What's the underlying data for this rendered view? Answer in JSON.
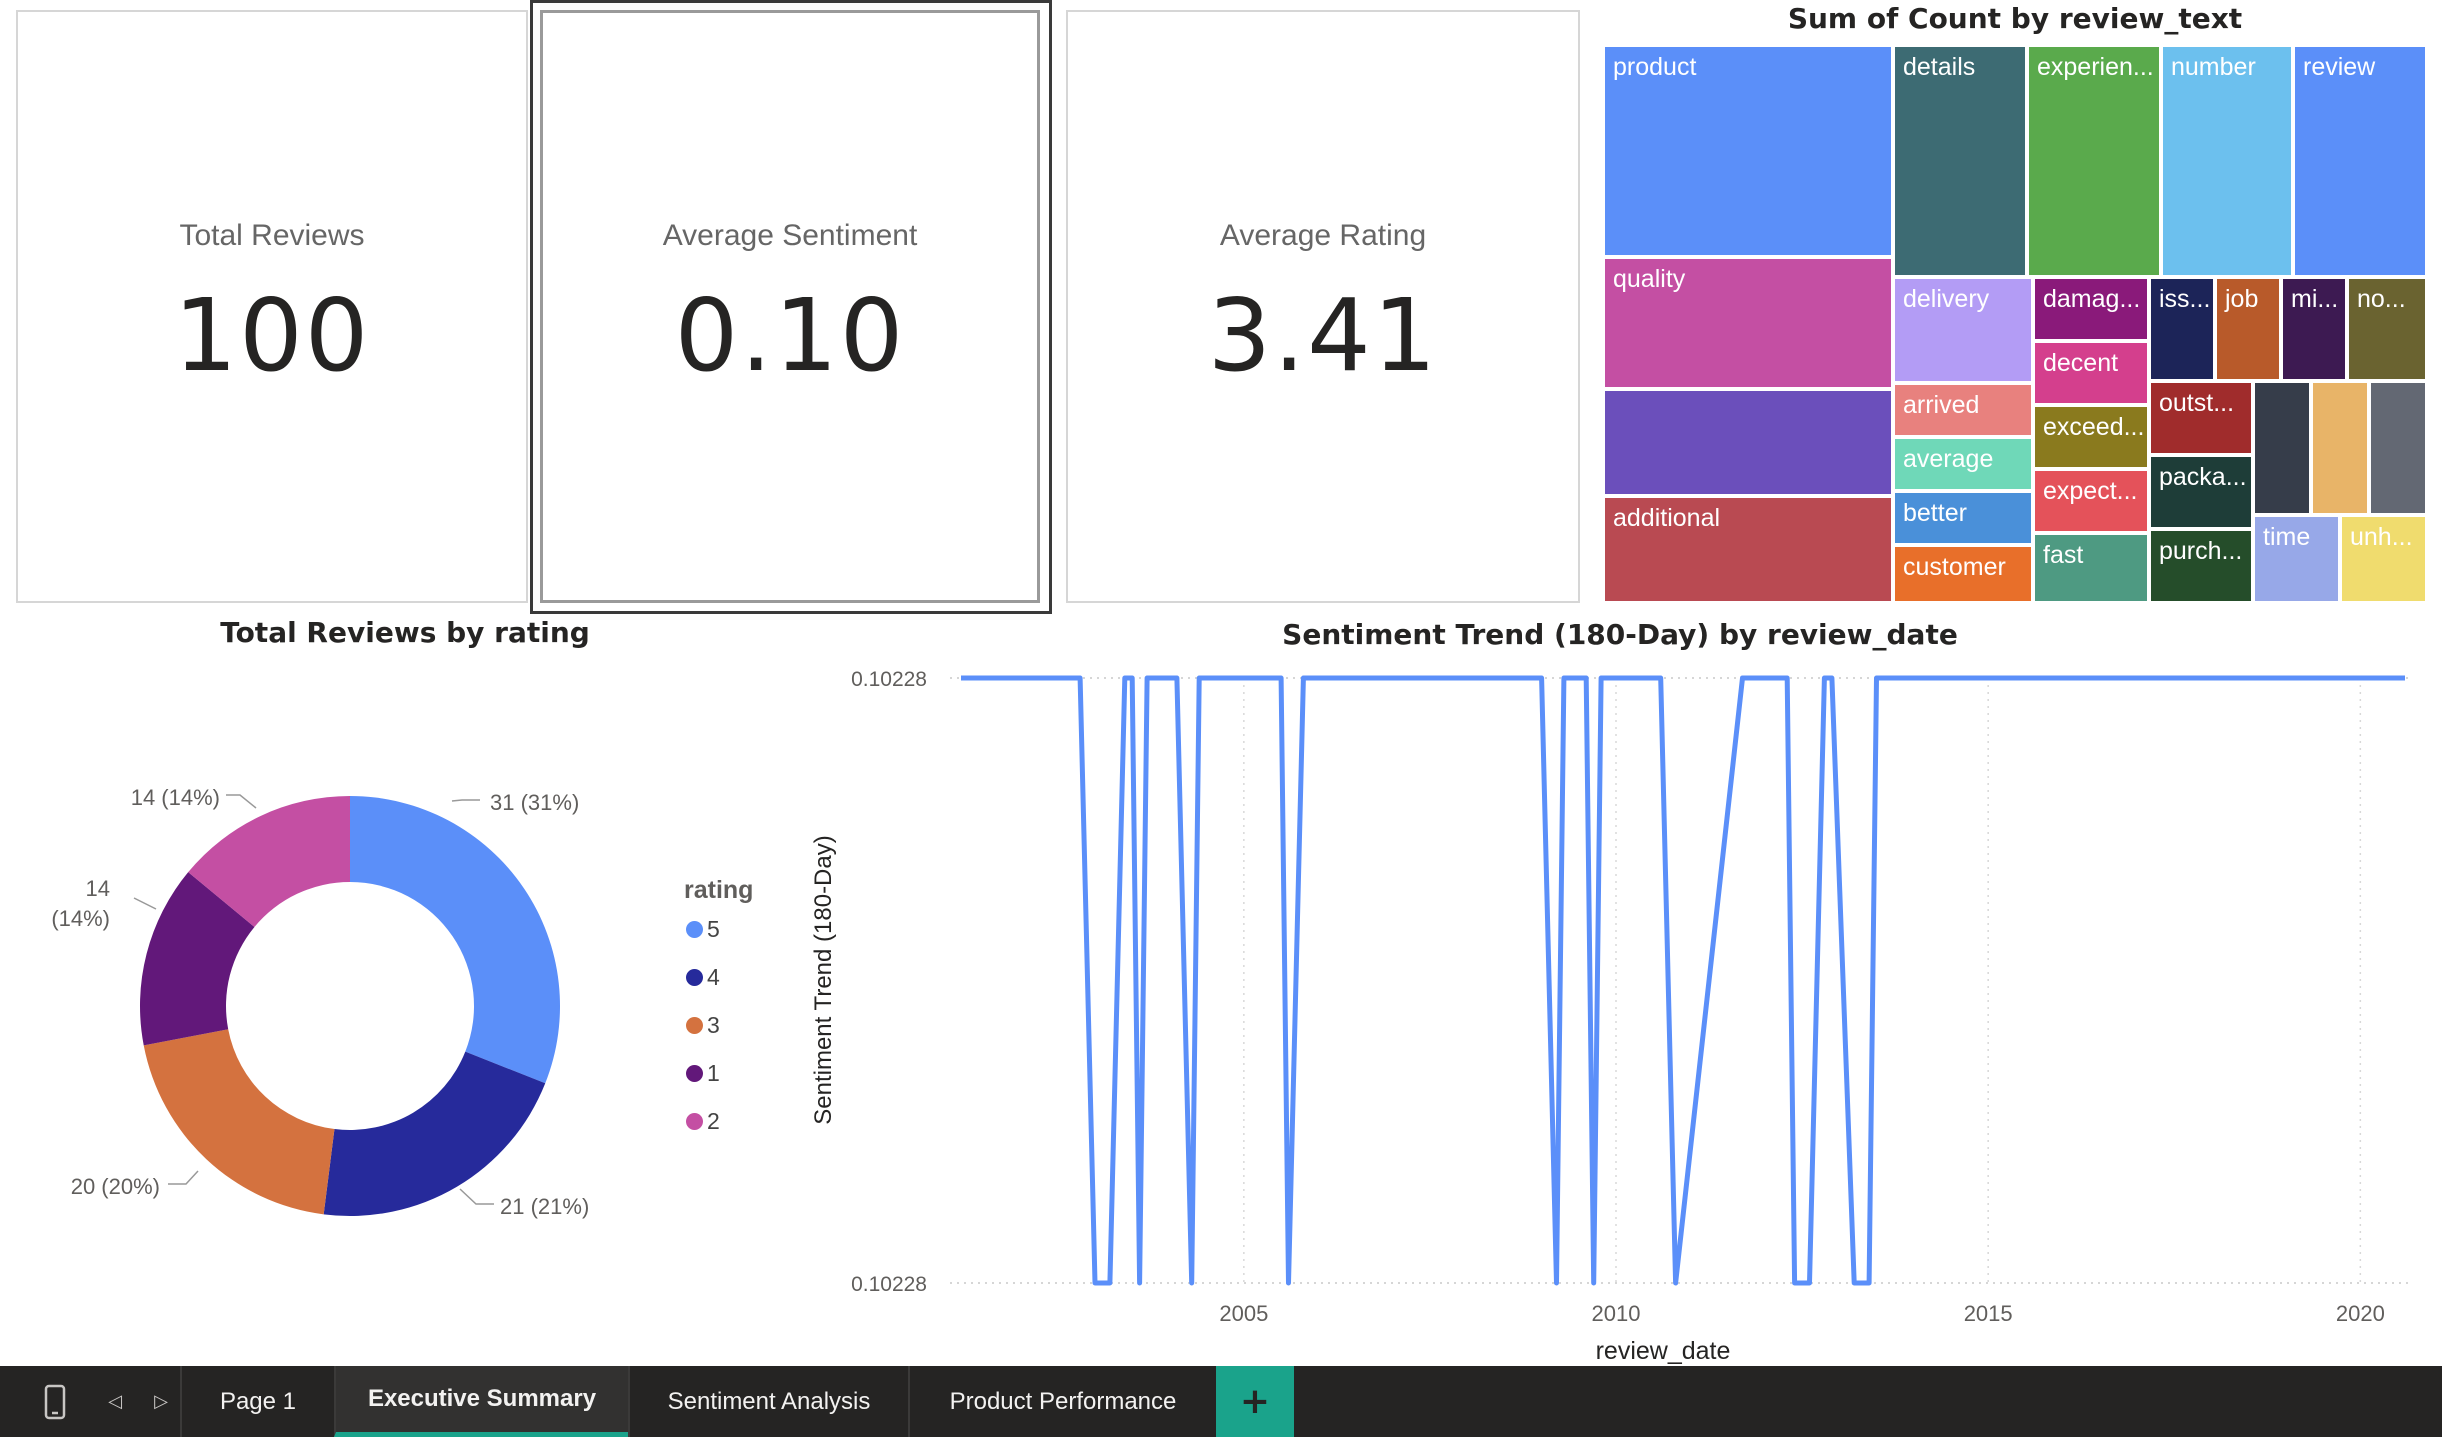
{
  "cards": [
    {
      "label": "Total Reviews",
      "value": "100"
    },
    {
      "label": "Average Sentiment",
      "value": "0.10"
    },
    {
      "label": "Average Rating",
      "value": "3.41"
    }
  ],
  "treemap": {
    "title": "Sum of Count by review_text",
    "tiles": [
      {
        "label": "product",
        "color": "#5b8ff9"
      },
      {
        "label": "quality",
        "color": "#c44fa3"
      },
      {
        "label": "",
        "color": "#6b4fbb"
      },
      {
        "label": "additional",
        "color": "#b94a52"
      },
      {
        "label": "details",
        "color": "#3d6b73"
      },
      {
        "label": "experien...",
        "color": "#5aaa4c"
      },
      {
        "label": "number",
        "color": "#6cc0ee"
      },
      {
        "label": "review",
        "color": "#5b8ff9"
      },
      {
        "label": "delivery",
        "color": "#b39cf5"
      },
      {
        "label": "arrived",
        "color": "#e8817e"
      },
      {
        "label": "average",
        "color": "#6fd8b8"
      },
      {
        "label": "better",
        "color": "#4a90d9"
      },
      {
        "label": "customer",
        "color": "#e86f2a"
      },
      {
        "label": "damag...",
        "color": "#8a1a7a"
      },
      {
        "label": "decent",
        "color": "#d43f8d"
      },
      {
        "label": "exceed...",
        "color": "#8a7a1e"
      },
      {
        "label": "expect...",
        "color": "#e4525a"
      },
      {
        "label": "fast",
        "color": "#4e9a82"
      },
      {
        "label": "iss...",
        "color": "#1c2458"
      },
      {
        "label": "job",
        "color": "#b85a2a"
      },
      {
        "label": "mi...",
        "color": "#3d1a52"
      },
      {
        "label": "no...",
        "color": "#6a6330"
      },
      {
        "label": "outst...",
        "color": "#a02c2c"
      },
      {
        "label": "packa...",
        "color": "#1e3d38"
      },
      {
        "label": "purch...",
        "color": "#254d2a"
      },
      {
        "label": "",
        "color": "#363d4a"
      },
      {
        "label": "",
        "color": "#e8b468"
      },
      {
        "label": "",
        "color": "#636873"
      },
      {
        "label": "time",
        "color": "#97a8e8"
      },
      {
        "label": "unh...",
        "color": "#f0dc6e"
      }
    ]
  },
  "donut": {
    "title": "Total Reviews by rating",
    "legend_title": "rating",
    "legend": [
      {
        "label": "5",
        "color": "#5b8ff9"
      },
      {
        "label": "4",
        "color": "#262a9b"
      },
      {
        "label": "3",
        "color": "#d4723f"
      },
      {
        "label": "1",
        "color": "#62187a"
      },
      {
        "label": "2",
        "color": "#c44fa3"
      }
    ],
    "labels": {
      "five": "31 (31%)",
      "four": "21 (21%)",
      "three": "20 (20%)",
      "one_a": "14",
      "one_b": "(14%)",
      "two": "14 (14%)"
    }
  },
  "line": {
    "title": "Sentiment Trend (180-Day) by review_date",
    "xlabel": "review_date",
    "ylabel": "Sentiment Trend (180-Day)",
    "ytick_top": "0.10228",
    "ytick_bottom": "0.10228",
    "xticks": [
      "2005",
      "2010",
      "2015",
      "2020"
    ]
  },
  "chart_data": [
    {
      "type": "pie",
      "title": "Total Reviews by rating",
      "categories": [
        "5",
        "4",
        "3",
        "1",
        "2"
      ],
      "values": [
        31,
        21,
        20,
        14,
        14
      ],
      "legend": "right"
    },
    {
      "type": "line",
      "title": "Sentiment Trend (180-Day) by review_date",
      "xlabel": "review_date",
      "ylabel": "Sentiment Trend (180-Day)",
      "x": [
        2001.2,
        2002.8,
        2003.0,
        2003.2,
        2003.4,
        2003.5,
        2003.6,
        2003.7,
        2003.8,
        2003.9,
        2004.1,
        2004.3,
        2004.4,
        2004.6,
        2005.5,
        2005.6,
        2005.8,
        2009.0,
        2009.2,
        2009.3,
        2009.6,
        2009.7,
        2009.8,
        2010.6,
        2010.8,
        2011.7,
        2012.3,
        2012.4,
        2012.6,
        2012.8,
        2012.9,
        2013.2,
        2013.4,
        2013.5,
        2013.8,
        2020.6
      ],
      "values": [
        1,
        1,
        0,
        0,
        1,
        1,
        0,
        1,
        1,
        1,
        1,
        0,
        1,
        1,
        1,
        0,
        1,
        1,
        0,
        1,
        1,
        0,
        1,
        1,
        0,
        1,
        1,
        0,
        0,
        1,
        1,
        0,
        0,
        1,
        1,
        1
      ],
      "series": [
        {
          "name": "Sentiment Trend (180-Day)"
        }
      ],
      "yticks": [
        "0.10228",
        "0.10228"
      ],
      "xticks": [
        "2005",
        "2010",
        "2015",
        "2020"
      ],
      "grid": true
    },
    {
      "type": "treemap",
      "title": "Sum of Count by review_text"
    }
  ],
  "tabs": {
    "items": [
      "Page 1",
      "Executive Summary",
      "Sentiment Analysis",
      "Product Performance"
    ],
    "active": "Executive Summary",
    "add": "+"
  }
}
